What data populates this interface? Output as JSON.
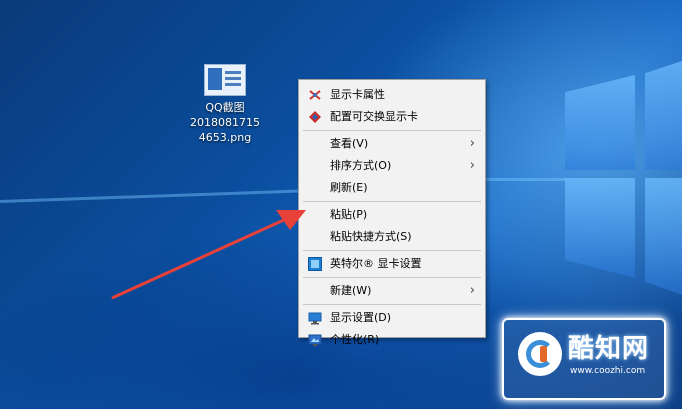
{
  "desktop_icon": {
    "name_line1": "QQ截图",
    "name_line2": "2018081715",
    "name_line3": "4653.png"
  },
  "context_menu": {
    "groups": [
      [
        {
          "label": "显示卡属性",
          "icon": "graphics-properties-icon"
        },
        {
          "label": "配置可交换显示卡",
          "icon": "switchable-graphics-icon"
        }
      ],
      [
        {
          "label": "查看(V)",
          "submenu": true
        },
        {
          "label": "排序方式(O)",
          "submenu": true
        },
        {
          "label": "刷新(E)"
        }
      ],
      [
        {
          "label": "粘贴(P)"
        },
        {
          "label": "粘贴快捷方式(S)"
        }
      ],
      [
        {
          "label": "英特尔® 显卡设置",
          "icon": "intel-graphics-icon"
        }
      ],
      [
        {
          "label": "新建(W)",
          "submenu": true
        }
      ],
      [
        {
          "label": "显示设置(D)",
          "icon": "display-settings-icon"
        },
        {
          "label": "个性化(R)",
          "icon": "personalize-icon"
        }
      ]
    ]
  },
  "arrow_annotation": {
    "color": "#e8413a"
  },
  "watermark": {
    "brand": "酷知网",
    "url": "www.coozhi.com"
  }
}
